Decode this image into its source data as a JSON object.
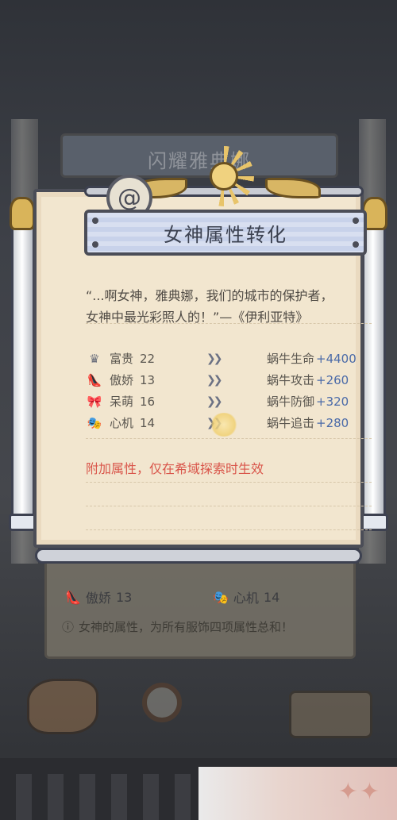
{
  "background": {
    "title": "闪耀雅典娜",
    "stats": [
      {
        "icon": "shoe-icon",
        "label": "傲娇",
        "value": "13"
      },
      {
        "icon": "mask-icon",
        "label": "心机",
        "value": "14"
      }
    ],
    "note": "女神的属性，为所有服饰四项属性总和！"
  },
  "modal": {
    "title": "女神属性转化",
    "quote_line1": "“...啊女神，雅典娜，我们的城市的保护者，",
    "quote_line2": "女神中最光彩照人的！”—《伊利亚特》",
    "stats": [
      {
        "icon": "crown-icon",
        "label": "富贵",
        "value": "22",
        "target": "蜗牛生命",
        "bonus": "+4400"
      },
      {
        "icon": "shoe-icon",
        "label": "傲娇",
        "value": "13",
        "target": "蜗牛攻击",
        "bonus": "+260"
      },
      {
        "icon": "bow-icon",
        "label": "呆萌",
        "value": "16",
        "target": "蜗牛防御",
        "bonus": "+320"
      },
      {
        "icon": "mask-icon",
        "label": "心机",
        "value": "14",
        "target": "蜗牛追击",
        "bonus": "+280"
      }
    ],
    "notice": "附加属性，仅在希域探索时生效"
  },
  "colors": {
    "bonus": "#4a6aa8",
    "notice": "#d9554a",
    "parchment": "#f2e6cf",
    "title_plate": "#d8dff0"
  }
}
